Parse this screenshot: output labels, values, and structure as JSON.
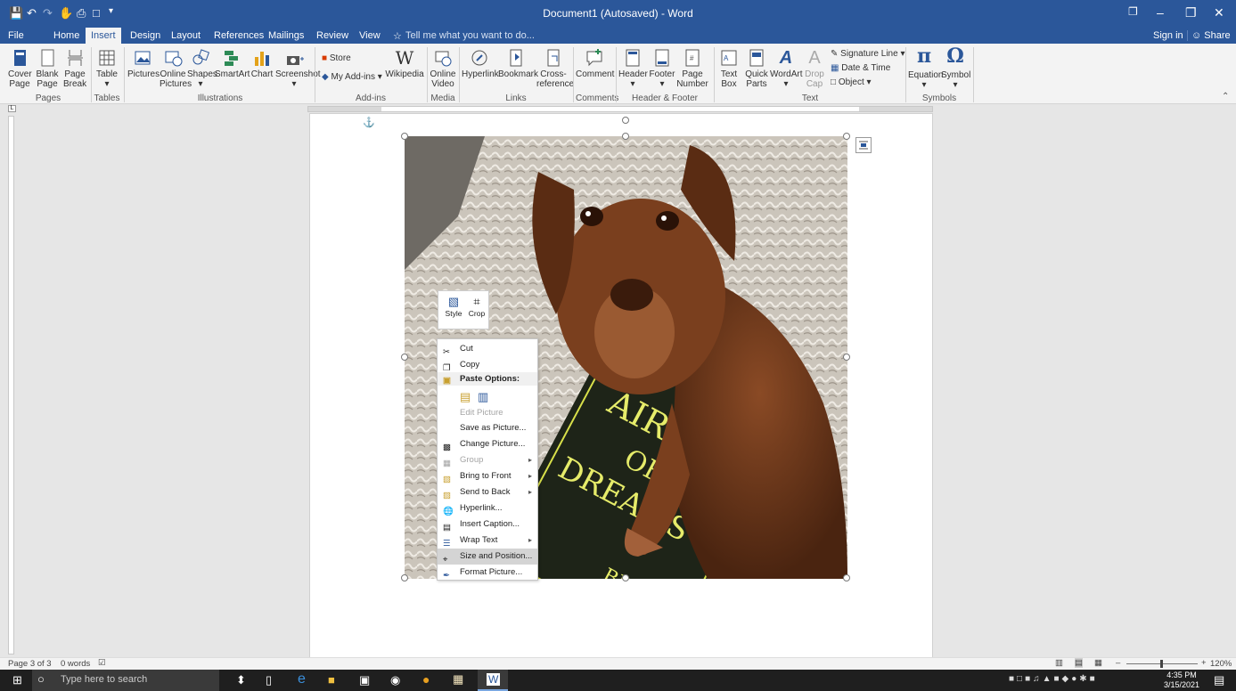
{
  "window": {
    "title": "Document1 (Autosaved) - Word",
    "sign_in": "Sign in",
    "share": "Share"
  },
  "tabs": [
    "File",
    "Home",
    "Insert",
    "Design",
    "Layout",
    "References",
    "Mailings",
    "Review",
    "View"
  ],
  "tell_me": "Tell me what you want to do...",
  "ribbon": {
    "pages": {
      "cover": [
        "Cover",
        "Page"
      ],
      "blank": [
        "Blank",
        "Page"
      ],
      "break": [
        "Page",
        "Break"
      ],
      "label": "Pages"
    },
    "tables": {
      "table": "Table",
      "label": "Tables"
    },
    "illustrations": {
      "pictures": "Pictures",
      "online": [
        "Online",
        "Pictures"
      ],
      "shapes": "Shapes",
      "smartart": "SmartArt",
      "chart": "Chart",
      "screenshot": "Screenshot",
      "label": "Illustrations"
    },
    "addins": {
      "store": "Store",
      "myaddins": "My Add-ins",
      "wikipedia": "Wikipedia",
      "label": "Add-ins"
    },
    "media": {
      "online_video": [
        "Online",
        "Video"
      ],
      "label": "Media"
    },
    "links": {
      "hyperlink": "Hyperlink",
      "bookmark": "Bookmark",
      "cross": [
        "Cross-",
        "reference"
      ],
      "label": "Links"
    },
    "comments": {
      "comment": "Comment",
      "label": "Comments"
    },
    "header_footer": {
      "header": "Header",
      "footer": "Footer",
      "page_number": [
        "Page",
        "Number"
      ],
      "label": "Header & Footer"
    },
    "text": {
      "textbox": [
        "Text",
        "Box"
      ],
      "quick": [
        "Quick",
        "Parts"
      ],
      "wordart": "WordArt",
      "dropcap": [
        "Drop",
        "Cap"
      ],
      "signature": "Signature Line",
      "datetime": "Date & Time",
      "object": "Object",
      "label": "Text"
    },
    "symbols": {
      "equation": "Equation",
      "symbol": "Symbol",
      "label": "Symbols"
    }
  },
  "minibar": {
    "style": "Style",
    "crop": "Crop"
  },
  "context_menu": [
    {
      "label": "Cut",
      "icon": "scissors-icon",
      "enabled": true
    },
    {
      "label": "Copy",
      "icon": "copy-icon",
      "enabled": true
    },
    {
      "label": "Paste Options:",
      "icon": "paste-icon",
      "enabled": true,
      "header": true
    },
    {
      "label": "",
      "icon": "paste-options-icon",
      "enabled": true
    },
    {
      "label": "Edit Picture",
      "icon": "",
      "enabled": false
    },
    {
      "label": "Save as Picture...",
      "icon": "",
      "enabled": true
    },
    {
      "label": "Change Picture...",
      "icon": "change-picture-icon",
      "enabled": true
    },
    {
      "label": "Group",
      "icon": "group-icon",
      "enabled": false,
      "submenu": true
    },
    {
      "label": "Bring to Front",
      "icon": "bring-front-icon",
      "enabled": true,
      "submenu": true
    },
    {
      "label": "Send to Back",
      "icon": "send-back-icon",
      "enabled": true,
      "submenu": true
    },
    {
      "label": "Hyperlink...",
      "icon": "hyperlink-icon",
      "enabled": true
    },
    {
      "label": "Insert Caption...",
      "icon": "caption-icon",
      "enabled": true
    },
    {
      "label": "Wrap Text",
      "icon": "wrap-text-icon",
      "enabled": true,
      "submenu": true
    },
    {
      "label": "Size and Position...",
      "icon": "size-position-icon",
      "enabled": true,
      "highlighted": true
    },
    {
      "label": "Format Picture...",
      "icon": "format-picture-icon",
      "enabled": true
    }
  ],
  "status": {
    "page": "Page 3 of 3",
    "words": "0 words",
    "zoom": "120%"
  },
  "taskbar": {
    "search": "Type here to search",
    "time": "4:35 PM",
    "date": "3/15/2021"
  },
  "photo": {
    "book_title_line1": "AIR",
    "book_title_line2": "OF",
    "book_title_line3": "DREAMS",
    "book_author": "BRAY"
  },
  "colors": {
    "title_blue": "#2b579a",
    "ribbon_bg": "#f3f3f3"
  }
}
